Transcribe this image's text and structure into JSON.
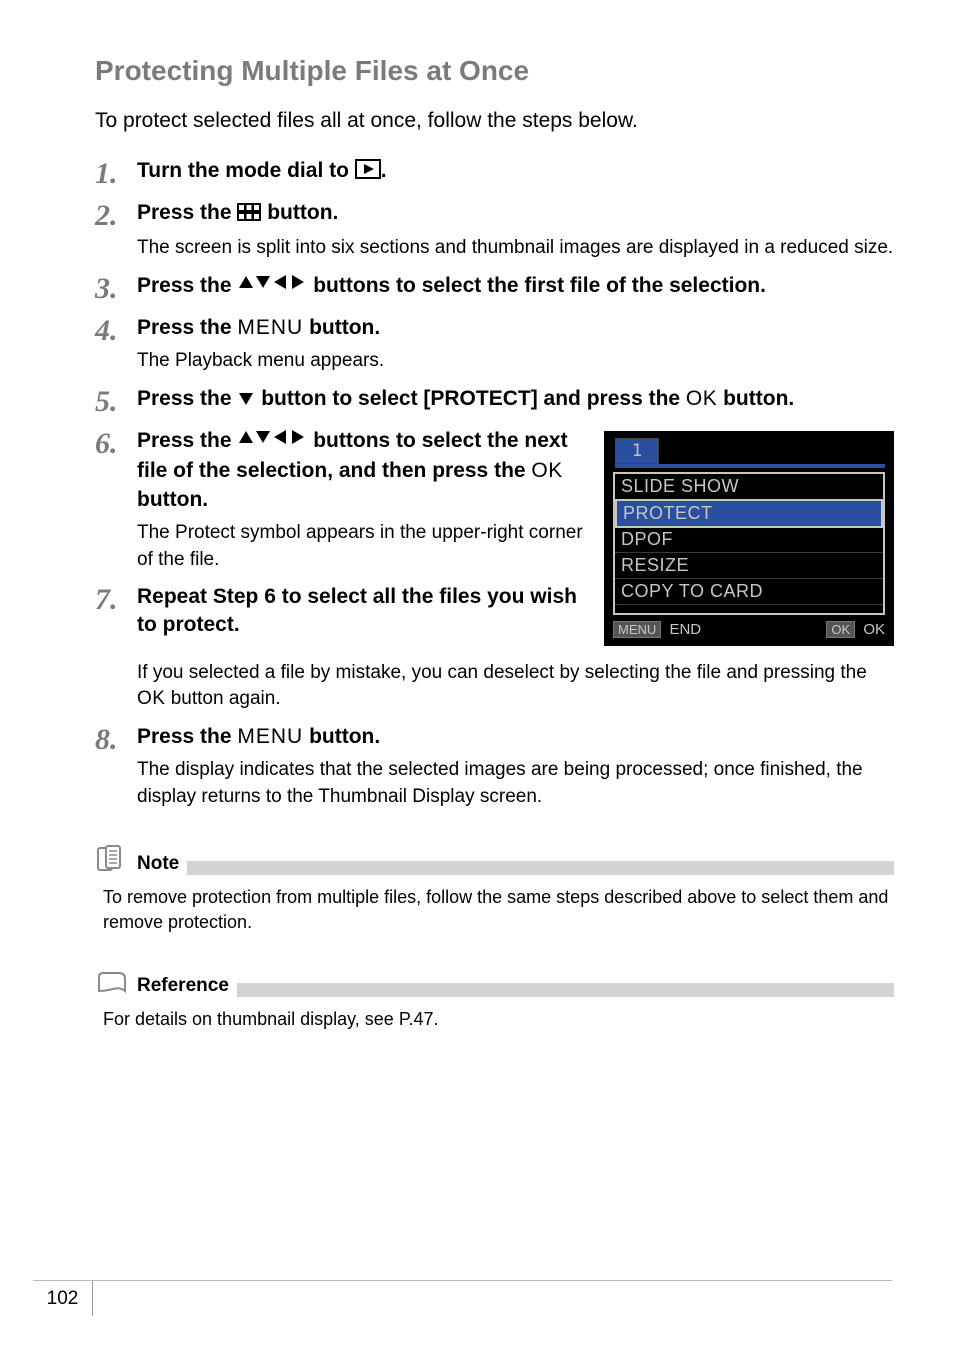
{
  "section_title": "Protecting Multiple Files at Once",
  "intro": "To protect selected files all at once, follow the steps below.",
  "steps": {
    "s1": {
      "num": "1.",
      "head_a": "Turn the mode dial to ",
      "head_b": "."
    },
    "s2": {
      "num": "2.",
      "head_a": "Press the ",
      "head_b": " button.",
      "desc": "The screen is split into six sections and thumbnail images are displayed in a reduced size."
    },
    "s3": {
      "num": "3.",
      "head_a": "Press the ",
      "head_b": " buttons to select the first file of the selection."
    },
    "s4": {
      "num": "4.",
      "head_a": "Press the ",
      "menu": "MENU",
      "head_b": " button.",
      "desc": "The Playback menu appears."
    },
    "s5": {
      "num": "5.",
      "head_a": "Press the ",
      "head_b": " button to select [PROTECT] and press the ",
      "ok": "OK",
      "head_c": " button."
    },
    "s6": {
      "num": "6.",
      "head_a": "Press the ",
      "head_b": " buttons to select the next file of the selection, and then press the ",
      "ok": "OK",
      "head_c": " button.",
      "desc": "The Protect symbol appears in the upper-right corner of the file."
    },
    "s7": {
      "num": "7.",
      "head": "Repeat Step 6 to select all the files you wish to protect.",
      "desc_a": "If you selected a file by mistake, you can deselect by selecting the file and pressing the ",
      "ok": "OK",
      "desc_b": " button again."
    },
    "s8": {
      "num": "8.",
      "head_a": "Press the ",
      "menu": "MENU",
      "head_b": " button.",
      "desc": "The display indicates that the selected images are being processed; once finished, the display returns to the Thumbnail Display screen."
    }
  },
  "screenshot": {
    "tab": "1",
    "items": [
      "SLIDE SHOW",
      "PROTECT",
      "DPOF",
      "RESIZE",
      "COPY TO CARD"
    ],
    "selected_index": 1,
    "footer_left_btn": "MENU",
    "footer_left_text": "END",
    "footer_right_btn": "OK",
    "footer_right_text": "OK"
  },
  "note": {
    "label": "Note",
    "text": "To remove protection from multiple files, follow the same steps described above to select them and remove protection."
  },
  "reference": {
    "label": "Reference",
    "text": "For details on thumbnail display, see P.47."
  },
  "page_number": "102"
}
